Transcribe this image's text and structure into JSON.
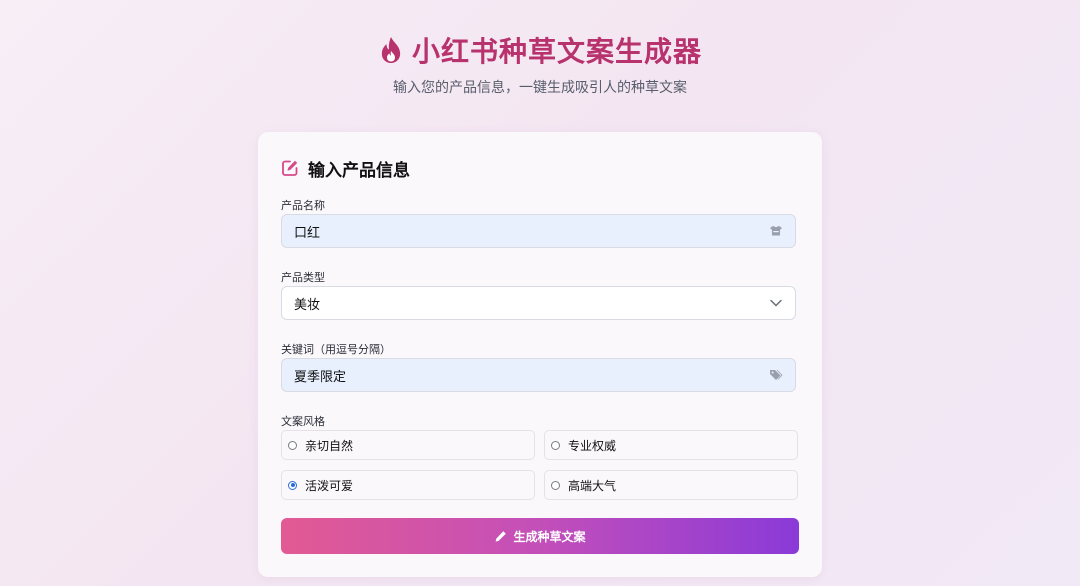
{
  "header": {
    "title": "小红书种草文案生成器",
    "subtitle": "输入您的产品信息，一键生成吸引人的种草文案",
    "icon": "fire-icon"
  },
  "card": {
    "title": "输入产品信息",
    "title_icon": "edit-icon"
  },
  "form": {
    "product_name": {
      "label": "产品名称",
      "value": "口红",
      "icon": "box-icon"
    },
    "product_type": {
      "label": "产品类型",
      "selected": "美妆",
      "icon": "chevron-down-icon"
    },
    "keywords": {
      "label": "关键词（用逗号分隔）",
      "value": "夏季限定",
      "icon": "tags-icon"
    },
    "style": {
      "label": "文案风格",
      "options": [
        {
          "label": "亲切自然",
          "checked": false
        },
        {
          "label": "专业权威",
          "checked": false
        },
        {
          "label": "活泼可爱",
          "checked": true
        },
        {
          "label": "高端大气",
          "checked": false
        }
      ]
    }
  },
  "actions": {
    "generate_label": "生成种草文案",
    "generate_icon": "pencil-icon"
  },
  "colors": {
    "brand": "#b8326d",
    "accent_pink": "#e25a93",
    "accent_purple": "#8a3ad8",
    "input_fill": "#e8f0fe",
    "radio_checked": "#2a6bd9"
  }
}
